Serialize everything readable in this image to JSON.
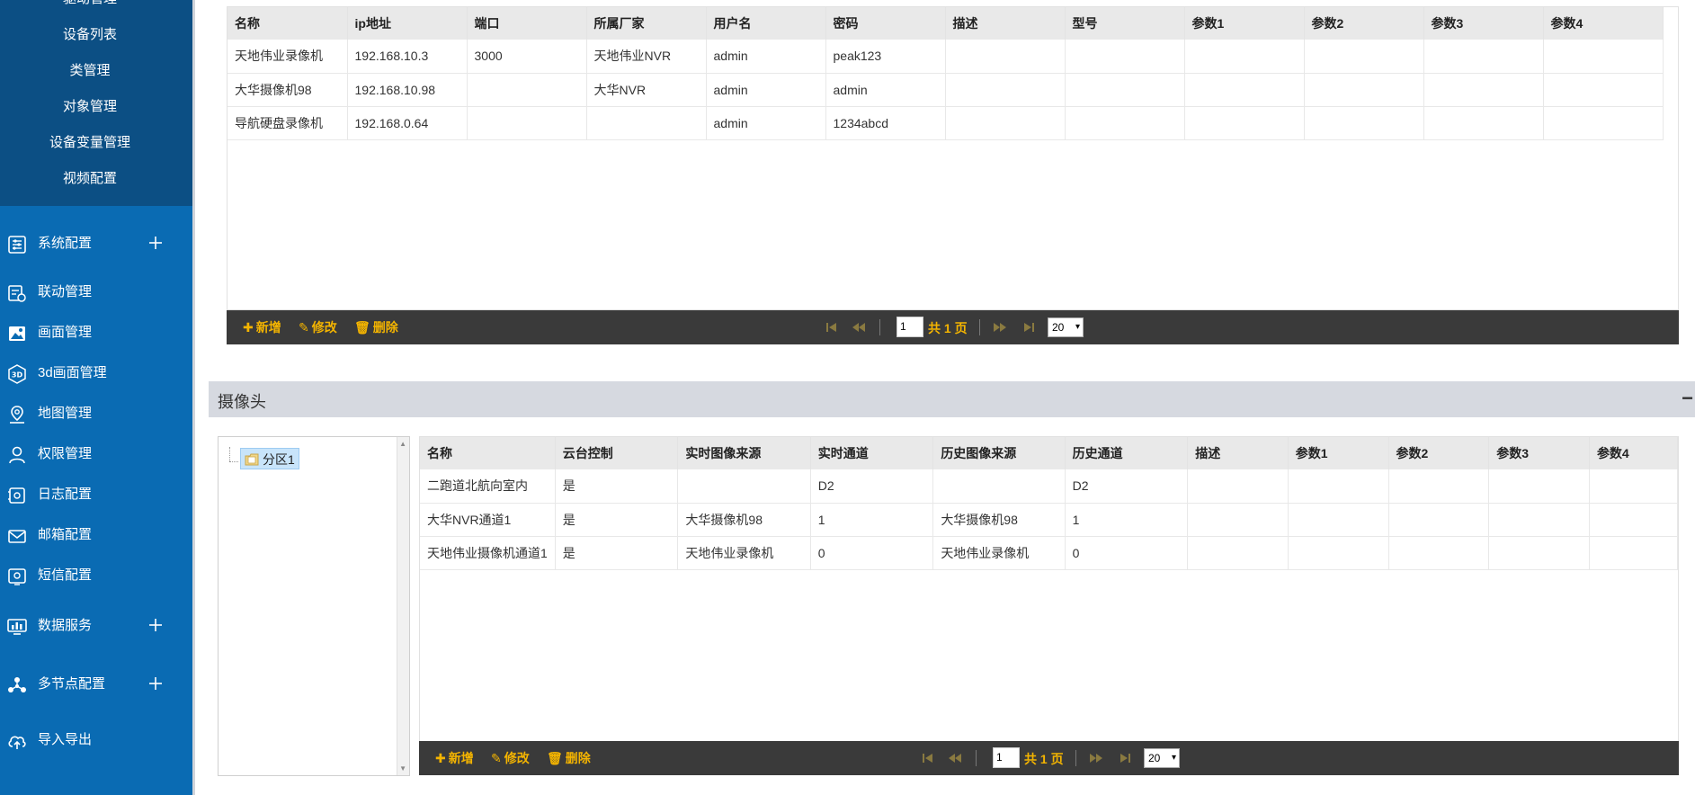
{
  "sidebar": {
    "sub_items": [
      "驱动管理",
      "设备列表",
      "类管理",
      "对象管理",
      "设备变量管理",
      "视频配置"
    ],
    "items": [
      {
        "label": "系统配置",
        "icon": "sliders-icon",
        "expandable": true
      },
      {
        "label": "联动管理",
        "icon": "linkage-doc-icon",
        "expandable": false
      },
      {
        "label": "画面管理",
        "icon": "image-icon",
        "expandable": false
      },
      {
        "label": "3d画面管理",
        "icon": "3d-icon",
        "expandable": false
      },
      {
        "label": "地图管理",
        "icon": "map-pin-icon",
        "expandable": false
      },
      {
        "label": "权限管理",
        "icon": "user-icon",
        "expandable": false
      },
      {
        "label": "日志配置",
        "icon": "log-icon",
        "expandable": false
      },
      {
        "label": "邮箱配置",
        "icon": "mail-icon",
        "expandable": false
      },
      {
        "label": "短信配置",
        "icon": "sms-icon",
        "expandable": false
      },
      {
        "label": "数据服务",
        "icon": "monitor-chart-icon",
        "expandable": true
      },
      {
        "label": "多节点配置",
        "icon": "nodes-icon",
        "expandable": true
      },
      {
        "label": "导入导出",
        "icon": "cloud-upload-icon",
        "expandable": false
      }
    ]
  },
  "recorder_table": {
    "headers": [
      "名称",
      "ip地址",
      "端口",
      "所属厂家",
      "用户名",
      "密码",
      "描述",
      "型号",
      "参数1",
      "参数2",
      "参数3",
      "参数4"
    ],
    "rows": [
      [
        "天地伟业录像机",
        "192.168.10.3",
        "3000",
        "天地伟业NVR",
        "admin",
        "peak123",
        "",
        "",
        "",
        "",
        "",
        ""
      ],
      [
        "大华摄像机98",
        "192.168.10.98",
        "",
        "大华NVR",
        "admin",
        "admin",
        "",
        "",
        "",
        "",
        "",
        ""
      ],
      [
        "导航硬盘录像机",
        "192.168.0.64",
        "",
        "",
        "admin",
        "1234abcd",
        "",
        "",
        "",
        "",
        "",
        ""
      ]
    ]
  },
  "toolbar": {
    "add_label": "新增",
    "edit_label": "修改",
    "delete_label": "删除",
    "page_value": "1",
    "total_pages": "共 1 页",
    "page_size": "20"
  },
  "camera_panel": {
    "title": "摄像头",
    "collapse_glyph": "−"
  },
  "tree": {
    "node_label": "分区1"
  },
  "camera_table": {
    "headers": [
      "名称",
      "云台控制",
      "实时图像来源",
      "实时通道",
      "历史图像来源",
      "历史通道",
      "描述",
      "参数1",
      "参数2",
      "参数3",
      "参数4"
    ],
    "rows": [
      [
        "二跑道北航向室内",
        "是",
        "",
        "D2",
        "",
        "D2",
        "",
        "",
        "",
        "",
        ""
      ],
      [
        "大华NVR通道1",
        "是",
        "大华摄像机98",
        "1",
        "大华摄像机98",
        "1",
        "",
        "",
        "",
        "",
        ""
      ],
      [
        "天地伟业摄像机通道1",
        "是",
        "天地伟业录像机",
        "0",
        "天地伟业录像机",
        "0",
        "",
        "",
        "",
        "",
        ""
      ]
    ]
  },
  "colors": {
    "sidebar": "#0a6bb3",
    "sidebar_sub": "#0c4f84",
    "toolbar_bg": "#3a3a3a",
    "toolbar_accent": "#f4b400"
  }
}
